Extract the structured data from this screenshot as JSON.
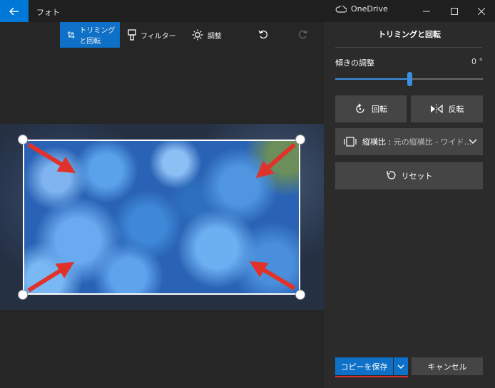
{
  "window": {
    "app_title": "フォト",
    "cloud_label": "OneDrive",
    "icons": [
      "back-arrow-icon",
      "cloud-icon",
      "minimize-icon",
      "maximize-icon",
      "close-icon"
    ]
  },
  "toolbar": {
    "crop_label": "トリミングと回転",
    "filter_label": "フィルター",
    "adjust_label": "調整",
    "icons": [
      "crop-icon",
      "filter-brush-icon",
      "brightness-icon",
      "undo-icon",
      "redo-icon"
    ]
  },
  "panel": {
    "title": "トリミングと回転",
    "straighten_label": "傾きの調整",
    "straighten_value": "0 °",
    "straighten_level": 0.5,
    "rotate_label": "回転",
    "flip_label": "反転",
    "aspect_label": "縦横比 :",
    "aspect_value": "元の縦横比 - ワイド...",
    "reset_label": "リセット"
  },
  "footer": {
    "save_copy_label": "コピーを保存",
    "cancel_label": "キャンセル"
  },
  "colors": {
    "accent": "#0e70c6",
    "arrow": "#e0322a",
    "panel_bg": "#2b2b2b",
    "button_bg": "#454545"
  }
}
